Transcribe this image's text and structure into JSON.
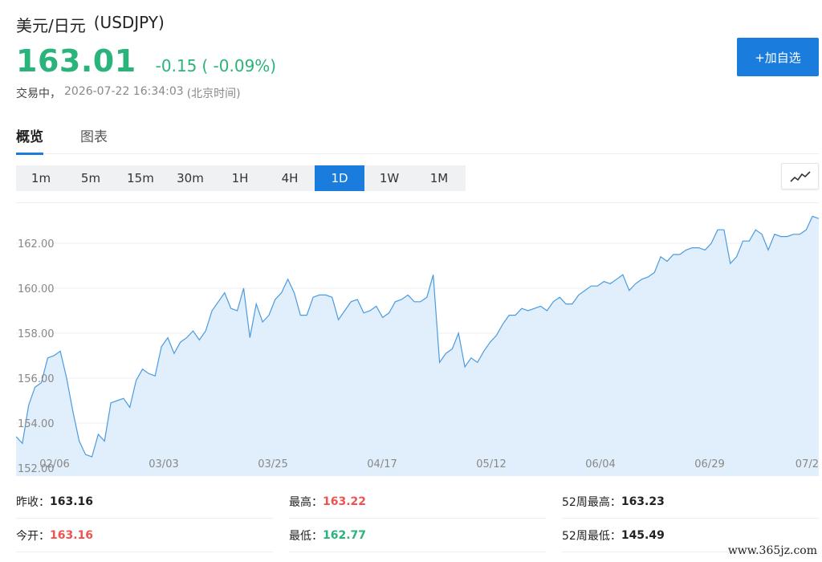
{
  "header": {
    "name": "美元/日元",
    "symbol": "(USDJPY)",
    "price": "163.01",
    "change": "-0.15",
    "change_pct": "( -0.09%)",
    "status": "交易中，",
    "timestamp": "2026-07-22 16:34:03",
    "timezone": "(北京时间)",
    "add_label": "+加自选"
  },
  "tabs": [
    {
      "label": "概览",
      "active": true
    },
    {
      "label": "图表",
      "active": false
    }
  ],
  "periods": [
    {
      "label": "1m",
      "active": false
    },
    {
      "label": "5m",
      "active": false
    },
    {
      "label": "15m",
      "active": false
    },
    {
      "label": "30m",
      "active": false
    },
    {
      "label": "1H",
      "active": false
    },
    {
      "label": "4H",
      "active": false
    },
    {
      "label": "1D",
      "active": true
    },
    {
      "label": "1W",
      "active": false
    },
    {
      "label": "1M",
      "active": false
    }
  ],
  "chart_data": {
    "type": "area",
    "ylim": [
      152.0,
      163.5
    ],
    "y_ticks": [
      "152.00",
      "154.00",
      "156.00",
      "158.00",
      "160.00",
      "162.00"
    ],
    "x_ticks": [
      "02/06",
      "03/03",
      "03/25",
      "04/17",
      "05/12",
      "06/04",
      "06/29",
      "07/2"
    ],
    "values": [
      153.4,
      153.1,
      154.8,
      155.6,
      155.8,
      156.9,
      157.0,
      157.2,
      156.0,
      154.5,
      153.2,
      152.6,
      152.5,
      153.5,
      153.2,
      154.9,
      155.0,
      155.1,
      154.7,
      155.9,
      156.4,
      156.2,
      156.1,
      157.4,
      157.8,
      157.1,
      157.6,
      157.8,
      158.1,
      157.7,
      158.1,
      159.0,
      159.4,
      159.8,
      159.1,
      159.0,
      160.0,
      157.8,
      159.3,
      158.5,
      158.8,
      159.5,
      159.8,
      160.4,
      159.8,
      158.8,
      158.8,
      159.6,
      159.7,
      159.7,
      159.6,
      158.6,
      159.0,
      159.4,
      159.5,
      158.9,
      159.0,
      159.2,
      158.7,
      158.9,
      159.4,
      159.5,
      159.7,
      159.4,
      159.4,
      159.6,
      160.6,
      156.7,
      157.1,
      157.3,
      158.0,
      156.5,
      156.9,
      156.7,
      157.2,
      157.6,
      157.9,
      158.4,
      158.8,
      158.8,
      159.1,
      159.0,
      159.1,
      159.2,
      159.0,
      159.4,
      159.6,
      159.3,
      159.3,
      159.7,
      159.9,
      160.1,
      160.1,
      160.3,
      160.2,
      160.4,
      160.6,
      159.9,
      160.2,
      160.4,
      160.5,
      160.7,
      161.4,
      161.2,
      161.5,
      161.5,
      161.7,
      161.8,
      161.8,
      161.7,
      162.0,
      162.6,
      162.6,
      161.1,
      161.4,
      162.1,
      162.1,
      162.6,
      162.4,
      161.7,
      162.4,
      162.3,
      162.3,
      162.4,
      162.4,
      162.6,
      163.2,
      163.1
    ]
  },
  "stats": [
    [
      {
        "label": "昨收：",
        "value": "163.16",
        "color": ""
      },
      {
        "label": "最高：",
        "value": "163.22",
        "color": "red"
      },
      {
        "label": "52周最高：",
        "value": "163.23",
        "color": ""
      }
    ],
    [
      {
        "label": "今开：",
        "value": "163.16",
        "color": "red"
      },
      {
        "label": "最低：",
        "value": "162.77",
        "color": "green"
      },
      {
        "label": "52周最低：",
        "value": "145.49",
        "color": ""
      }
    ]
  ],
  "watermark": "www.365jz.com",
  "colors": {
    "accent": "#1a7cdc",
    "up": "#ef5350",
    "down": "#2ab37a",
    "line": "#4a9be0",
    "fill": "#e1eefb"
  },
  "icons": {
    "chart_type": "line-chart-icon"
  }
}
